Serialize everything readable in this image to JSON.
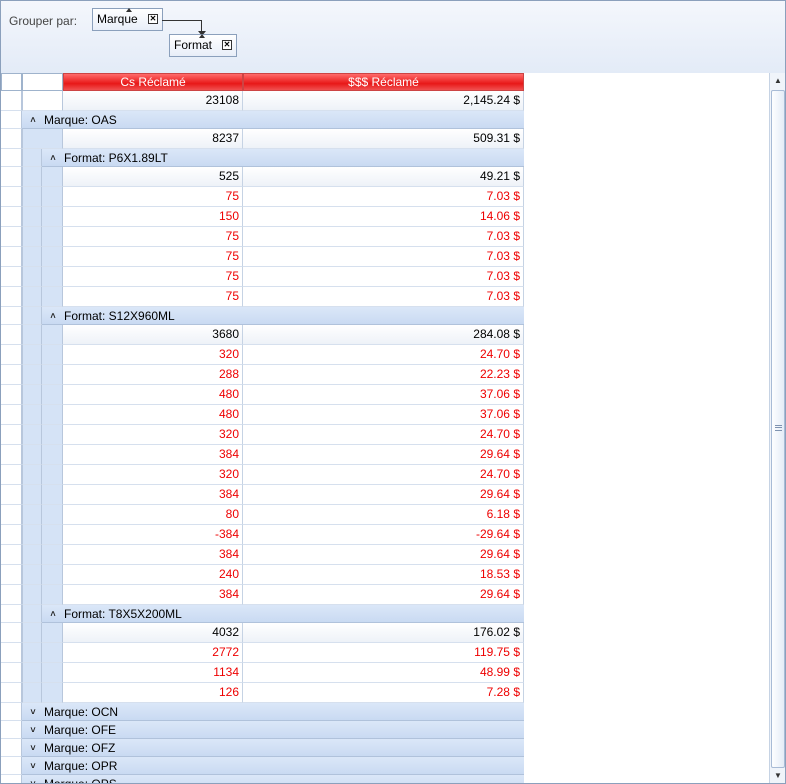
{
  "group_panel": {
    "label": "Grouper par:",
    "chips": [
      {
        "label": "Marque",
        "close": "✕"
      },
      {
        "label": "Format",
        "close": "✕"
      }
    ]
  },
  "columns": [
    "Cs Réclamé",
    "$$$ Réclamé"
  ],
  "rows": [
    {
      "type": "sum",
      "cs": "23108",
      "amount": "2,145.24 $",
      "level": 0
    },
    {
      "type": "group",
      "label": "Marque: OAS",
      "expanded": true,
      "level": 1
    },
    {
      "type": "sum",
      "cs": "8237",
      "amount": "509.31 $",
      "level": 1
    },
    {
      "type": "group",
      "label": "Format: P6X1.89LT",
      "expanded": true,
      "level": 2
    },
    {
      "type": "sum",
      "cs": "525",
      "amount": "49.21 $",
      "level": 2
    },
    {
      "type": "data",
      "cs": "75",
      "amount": "7.03 $"
    },
    {
      "type": "data",
      "cs": "150",
      "amount": "14.06 $"
    },
    {
      "type": "data",
      "cs": "75",
      "amount": "7.03 $"
    },
    {
      "type": "data",
      "cs": "75",
      "amount": "7.03 $"
    },
    {
      "type": "data",
      "cs": "75",
      "amount": "7.03 $"
    },
    {
      "type": "data",
      "cs": "75",
      "amount": "7.03 $"
    },
    {
      "type": "group",
      "label": "Format: S12X960ML",
      "expanded": true,
      "level": 2
    },
    {
      "type": "sum",
      "cs": "3680",
      "amount": "284.08 $",
      "level": 2
    },
    {
      "type": "data",
      "cs": "320",
      "amount": "24.70 $"
    },
    {
      "type": "data",
      "cs": "288",
      "amount": "22.23 $"
    },
    {
      "type": "data",
      "cs": "480",
      "amount": "37.06 $"
    },
    {
      "type": "data",
      "cs": "480",
      "amount": "37.06 $"
    },
    {
      "type": "data",
      "cs": "320",
      "amount": "24.70 $"
    },
    {
      "type": "data",
      "cs": "384",
      "amount": "29.64 $"
    },
    {
      "type": "data",
      "cs": "320",
      "amount": "24.70 $"
    },
    {
      "type": "data",
      "cs": "384",
      "amount": "29.64 $"
    },
    {
      "type": "data",
      "cs": "80",
      "amount": "6.18 $"
    },
    {
      "type": "data",
      "cs": "-384",
      "amount": "-29.64 $"
    },
    {
      "type": "data",
      "cs": "384",
      "amount": "29.64 $"
    },
    {
      "type": "data",
      "cs": "240",
      "amount": "18.53 $"
    },
    {
      "type": "data",
      "cs": "384",
      "amount": "29.64 $"
    },
    {
      "type": "group",
      "label": "Format: T8X5X200ML",
      "expanded": true,
      "level": 2
    },
    {
      "type": "sum",
      "cs": "4032",
      "amount": "176.02 $",
      "level": 2
    },
    {
      "type": "data",
      "cs": "2772",
      "amount": "119.75 $"
    },
    {
      "type": "data",
      "cs": "1134",
      "amount": "48.99 $"
    },
    {
      "type": "data",
      "cs": "126",
      "amount": "7.28 $"
    },
    {
      "type": "group",
      "label": "Marque: OCN",
      "expanded": false,
      "level": 1
    },
    {
      "type": "group",
      "label": "Marque: OFE",
      "expanded": false,
      "level": 1
    },
    {
      "type": "group",
      "label": "Marque: OFZ",
      "expanded": false,
      "level": 1
    },
    {
      "type": "group",
      "label": "Marque: OPR",
      "expanded": false,
      "level": 1
    },
    {
      "type": "group",
      "label": "Marque: OPS",
      "expanded": false,
      "level": 1
    }
  ],
  "icons": {
    "expand": "chevron-up-icon",
    "collapse": "chevron-down-icon"
  },
  "colors": {
    "header_red": "#e81818",
    "data_text": "#e00000",
    "group_bg": "#d5e3f6"
  }
}
